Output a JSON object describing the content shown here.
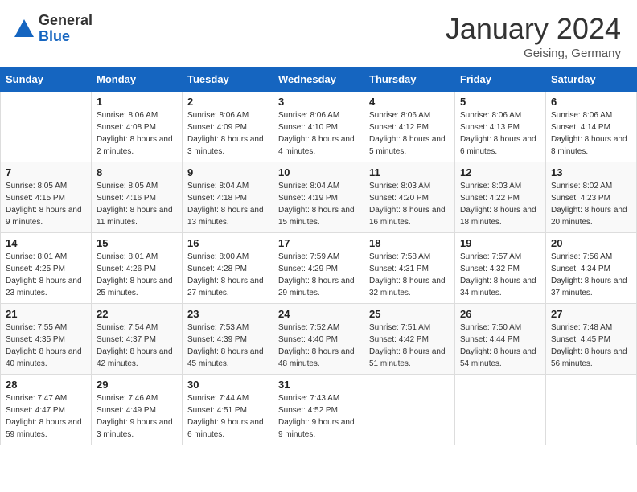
{
  "header": {
    "logo_general": "General",
    "logo_blue": "Blue",
    "month_year": "January 2024",
    "location": "Geising, Germany"
  },
  "days_of_week": [
    "Sunday",
    "Monday",
    "Tuesday",
    "Wednesday",
    "Thursday",
    "Friday",
    "Saturday"
  ],
  "weeks": [
    [
      {
        "day": "",
        "sunrise": "",
        "sunset": "",
        "daylight": ""
      },
      {
        "day": "1",
        "sunrise": "Sunrise: 8:06 AM",
        "sunset": "Sunset: 4:08 PM",
        "daylight": "Daylight: 8 hours and 2 minutes."
      },
      {
        "day": "2",
        "sunrise": "Sunrise: 8:06 AM",
        "sunset": "Sunset: 4:09 PM",
        "daylight": "Daylight: 8 hours and 3 minutes."
      },
      {
        "day": "3",
        "sunrise": "Sunrise: 8:06 AM",
        "sunset": "Sunset: 4:10 PM",
        "daylight": "Daylight: 8 hours and 4 minutes."
      },
      {
        "day": "4",
        "sunrise": "Sunrise: 8:06 AM",
        "sunset": "Sunset: 4:12 PM",
        "daylight": "Daylight: 8 hours and 5 minutes."
      },
      {
        "day": "5",
        "sunrise": "Sunrise: 8:06 AM",
        "sunset": "Sunset: 4:13 PM",
        "daylight": "Daylight: 8 hours and 6 minutes."
      },
      {
        "day": "6",
        "sunrise": "Sunrise: 8:06 AM",
        "sunset": "Sunset: 4:14 PM",
        "daylight": "Daylight: 8 hours and 8 minutes."
      }
    ],
    [
      {
        "day": "7",
        "sunrise": "Sunrise: 8:05 AM",
        "sunset": "Sunset: 4:15 PM",
        "daylight": "Daylight: 8 hours and 9 minutes."
      },
      {
        "day": "8",
        "sunrise": "Sunrise: 8:05 AM",
        "sunset": "Sunset: 4:16 PM",
        "daylight": "Daylight: 8 hours and 11 minutes."
      },
      {
        "day": "9",
        "sunrise": "Sunrise: 8:04 AM",
        "sunset": "Sunset: 4:18 PM",
        "daylight": "Daylight: 8 hours and 13 minutes."
      },
      {
        "day": "10",
        "sunrise": "Sunrise: 8:04 AM",
        "sunset": "Sunset: 4:19 PM",
        "daylight": "Daylight: 8 hours and 15 minutes."
      },
      {
        "day": "11",
        "sunrise": "Sunrise: 8:03 AM",
        "sunset": "Sunset: 4:20 PM",
        "daylight": "Daylight: 8 hours and 16 minutes."
      },
      {
        "day": "12",
        "sunrise": "Sunrise: 8:03 AM",
        "sunset": "Sunset: 4:22 PM",
        "daylight": "Daylight: 8 hours and 18 minutes."
      },
      {
        "day": "13",
        "sunrise": "Sunrise: 8:02 AM",
        "sunset": "Sunset: 4:23 PM",
        "daylight": "Daylight: 8 hours and 20 minutes."
      }
    ],
    [
      {
        "day": "14",
        "sunrise": "Sunrise: 8:01 AM",
        "sunset": "Sunset: 4:25 PM",
        "daylight": "Daylight: 8 hours and 23 minutes."
      },
      {
        "day": "15",
        "sunrise": "Sunrise: 8:01 AM",
        "sunset": "Sunset: 4:26 PM",
        "daylight": "Daylight: 8 hours and 25 minutes."
      },
      {
        "day": "16",
        "sunrise": "Sunrise: 8:00 AM",
        "sunset": "Sunset: 4:28 PM",
        "daylight": "Daylight: 8 hours and 27 minutes."
      },
      {
        "day": "17",
        "sunrise": "Sunrise: 7:59 AM",
        "sunset": "Sunset: 4:29 PM",
        "daylight": "Daylight: 8 hours and 29 minutes."
      },
      {
        "day": "18",
        "sunrise": "Sunrise: 7:58 AM",
        "sunset": "Sunset: 4:31 PM",
        "daylight": "Daylight: 8 hours and 32 minutes."
      },
      {
        "day": "19",
        "sunrise": "Sunrise: 7:57 AM",
        "sunset": "Sunset: 4:32 PM",
        "daylight": "Daylight: 8 hours and 34 minutes."
      },
      {
        "day": "20",
        "sunrise": "Sunrise: 7:56 AM",
        "sunset": "Sunset: 4:34 PM",
        "daylight": "Daylight: 8 hours and 37 minutes."
      }
    ],
    [
      {
        "day": "21",
        "sunrise": "Sunrise: 7:55 AM",
        "sunset": "Sunset: 4:35 PM",
        "daylight": "Daylight: 8 hours and 40 minutes."
      },
      {
        "day": "22",
        "sunrise": "Sunrise: 7:54 AM",
        "sunset": "Sunset: 4:37 PM",
        "daylight": "Daylight: 8 hours and 42 minutes."
      },
      {
        "day": "23",
        "sunrise": "Sunrise: 7:53 AM",
        "sunset": "Sunset: 4:39 PM",
        "daylight": "Daylight: 8 hours and 45 minutes."
      },
      {
        "day": "24",
        "sunrise": "Sunrise: 7:52 AM",
        "sunset": "Sunset: 4:40 PM",
        "daylight": "Daylight: 8 hours and 48 minutes."
      },
      {
        "day": "25",
        "sunrise": "Sunrise: 7:51 AM",
        "sunset": "Sunset: 4:42 PM",
        "daylight": "Daylight: 8 hours and 51 minutes."
      },
      {
        "day": "26",
        "sunrise": "Sunrise: 7:50 AM",
        "sunset": "Sunset: 4:44 PM",
        "daylight": "Daylight: 8 hours and 54 minutes."
      },
      {
        "day": "27",
        "sunrise": "Sunrise: 7:48 AM",
        "sunset": "Sunset: 4:45 PM",
        "daylight": "Daylight: 8 hours and 56 minutes."
      }
    ],
    [
      {
        "day": "28",
        "sunrise": "Sunrise: 7:47 AM",
        "sunset": "Sunset: 4:47 PM",
        "daylight": "Daylight: 8 hours and 59 minutes."
      },
      {
        "day": "29",
        "sunrise": "Sunrise: 7:46 AM",
        "sunset": "Sunset: 4:49 PM",
        "daylight": "Daylight: 9 hours and 3 minutes."
      },
      {
        "day": "30",
        "sunrise": "Sunrise: 7:44 AM",
        "sunset": "Sunset: 4:51 PM",
        "daylight": "Daylight: 9 hours and 6 minutes."
      },
      {
        "day": "31",
        "sunrise": "Sunrise: 7:43 AM",
        "sunset": "Sunset: 4:52 PM",
        "daylight": "Daylight: 9 hours and 9 minutes."
      },
      {
        "day": "",
        "sunrise": "",
        "sunset": "",
        "daylight": ""
      },
      {
        "day": "",
        "sunrise": "",
        "sunset": "",
        "daylight": ""
      },
      {
        "day": "",
        "sunrise": "",
        "sunset": "",
        "daylight": ""
      }
    ]
  ]
}
